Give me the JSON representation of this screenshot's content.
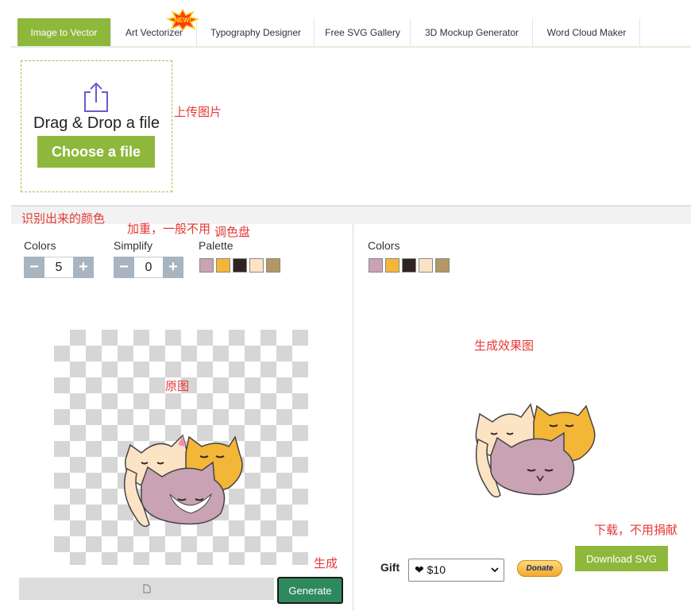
{
  "tabs": [
    {
      "label": "Image to Vector",
      "active": true
    },
    {
      "label": "Art Vectorizer",
      "badge": "NEW!"
    },
    {
      "label": "Typography Designer"
    },
    {
      "label": "Free SVG Gallery"
    },
    {
      "label": "3D Mockup Generator"
    },
    {
      "label": "Word Cloud Maker"
    }
  ],
  "upload": {
    "drag_text": "Drag & Drop a file",
    "choose_label": "Choose a file"
  },
  "left_panel": {
    "colors_label": "Colors",
    "colors_value": "5",
    "simplify_label": "Simplify",
    "simplify_value": "0",
    "palette_label": "Palette",
    "generate_label": "Generate"
  },
  "right_panel": {
    "colors_label": "Colors",
    "gift_label": "Gift",
    "gift_value": "❤ $10",
    "donate_label": "Donate",
    "download_label": "Download SVG"
  },
  "palette": [
    "#c9a2b3",
    "#f4b637",
    "#2f2320",
    "#fbe3c4",
    "#b39765"
  ],
  "annotations": {
    "upload": "上传图片",
    "detected_colors": "识别出来的颜色",
    "bold": "加重，一般不用",
    "palette": "调色盘",
    "original": "原图",
    "result": "生成效果图",
    "generate": "生成",
    "download": "下载，不用捐献"
  },
  "icons": {
    "upload": "upload-share-icon",
    "file": "file-icon",
    "minus": "minus-icon",
    "plus": "plus-icon"
  }
}
